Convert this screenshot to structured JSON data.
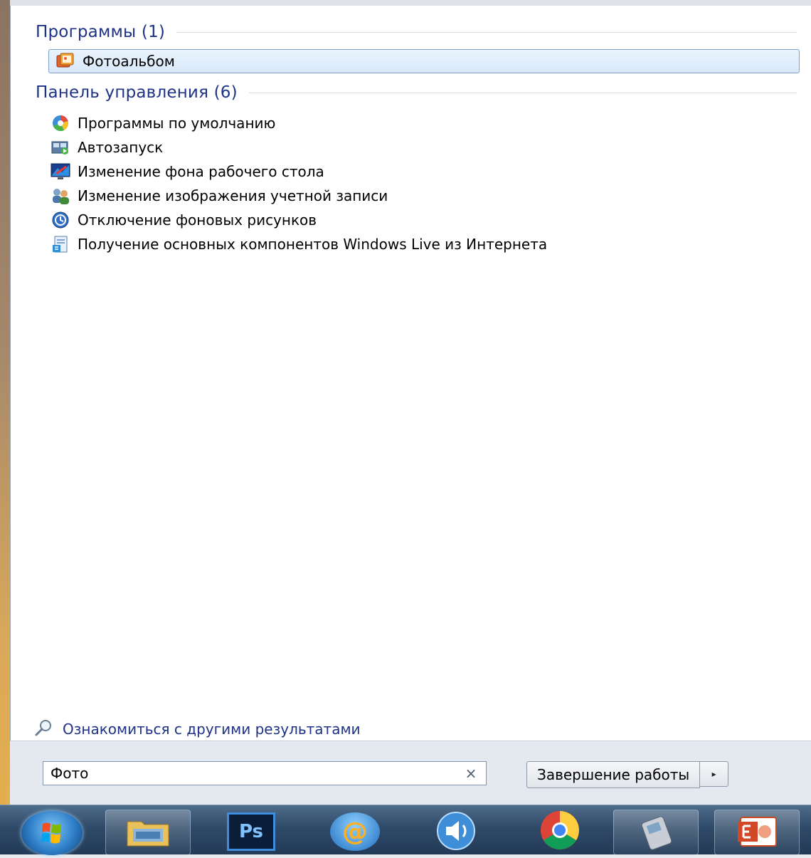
{
  "programs_header": "Программы (1)",
  "programs": [
    {
      "label": "Фотоальбом",
      "icon": "photo-album-icon",
      "selected": true
    }
  ],
  "control_panel_header": "Панель управления (6)",
  "control_panel": [
    {
      "label": "Программы по умолчанию",
      "icon": "default-programs-icon"
    },
    {
      "label": "Автозапуск",
      "icon": "autoplay-icon"
    },
    {
      "label": "Изменение фона рабочего стола",
      "icon": "desktop-background-icon"
    },
    {
      "label": "Изменение изображения учетной записи",
      "icon": "user-accounts-icon"
    },
    {
      "label": "Отключение фоновых рисунков",
      "icon": "ease-of-access-icon"
    },
    {
      "label": "Получение основных компонентов Windows Live из Интернета",
      "icon": "windows-live-download-icon"
    }
  ],
  "more_results": "Ознакомиться с другими результатами",
  "search": {
    "value": "Фото",
    "clear_glyph": "×"
  },
  "shutdown": {
    "label": "Завершение работы",
    "arrow_glyph": "▸"
  },
  "taskbar": {
    "items": [
      {
        "name": "explorer-icon"
      },
      {
        "name": "photoshop-icon",
        "text": "Ps"
      },
      {
        "name": "mail-agent-icon",
        "text": "@"
      },
      {
        "name": "speaker-icon"
      },
      {
        "name": "chrome-icon"
      },
      {
        "name": "mobile-phone-icon"
      },
      {
        "name": "powerpoint-icon"
      }
    ]
  }
}
